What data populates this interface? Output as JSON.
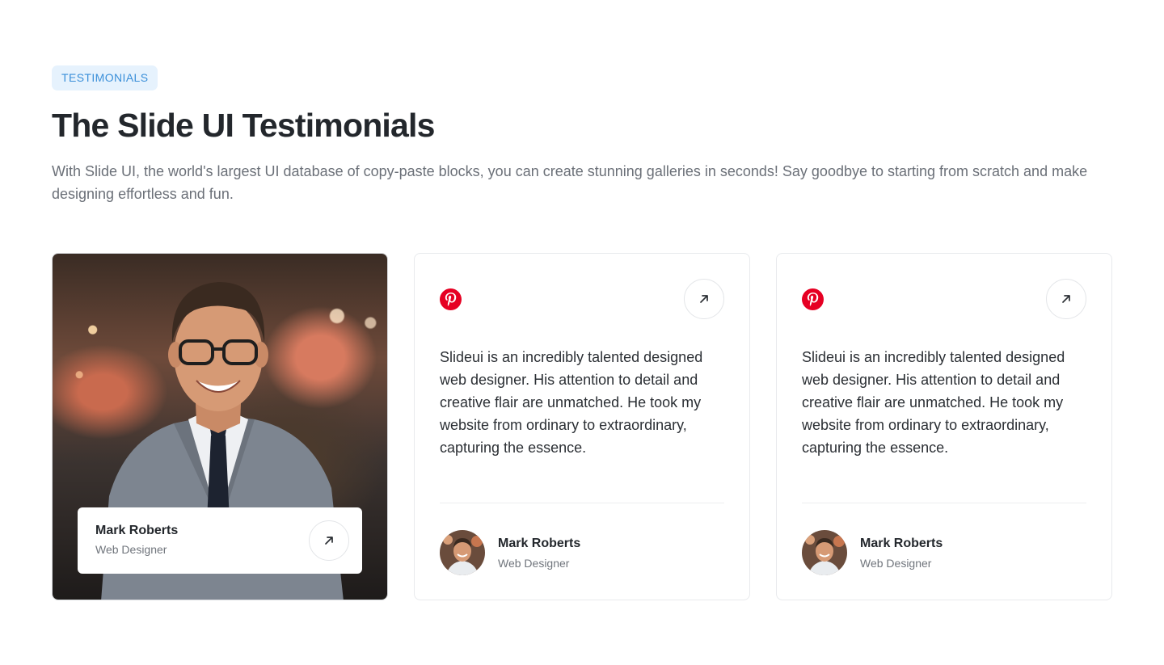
{
  "header": {
    "badge": "TESTIMONIALS",
    "title": "The Slide UI Testimonials",
    "subtitle": "With Slide UI, the world's largest UI database of copy-paste blocks, you can create stunning galleries in seconds! Say goodbye to starting from scratch and make designing effortless and fun."
  },
  "cards": [
    {
      "type": "photo",
      "name": "Mark Roberts",
      "role": "Web Designer"
    },
    {
      "type": "quote",
      "icon": "pinterest-icon",
      "quote": "Slideui is an incredibly talented designed web designer. His attention to detail and creative flair are unmatched. He took my website from ordinary to extraordinary, capturing the essence.",
      "name": "Mark Roberts",
      "role": "Web Designer"
    },
    {
      "type": "quote",
      "icon": "pinterest-icon",
      "quote": "Slideui is an incredibly talented designed web designer. His attention to detail and creative flair are unmatched. He took my website from ordinary to extraordinary, capturing the essence.",
      "name": "Mark Roberts",
      "role": "Web Designer"
    }
  ],
  "colors": {
    "badge_bg": "#e6f2fd",
    "badge_text": "#3a8fd9",
    "pinterest": "#e60023"
  }
}
